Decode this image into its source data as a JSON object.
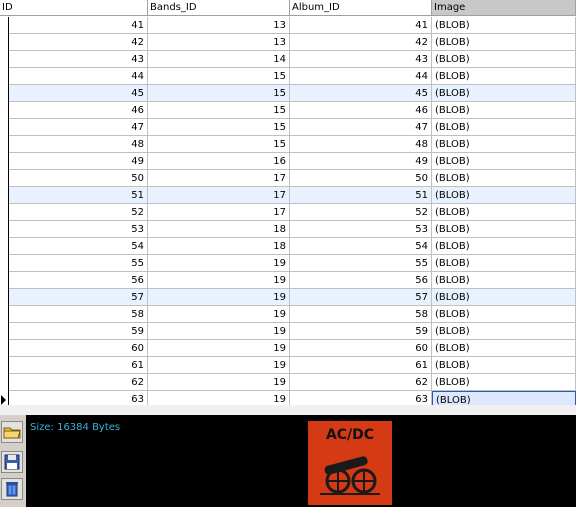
{
  "columns": [
    {
      "label": "ID"
    },
    {
      "label": "Bands_ID"
    },
    {
      "label": "Album_ID"
    },
    {
      "label": "Image"
    }
  ],
  "rows": [
    {
      "id": "41",
      "bands_id": "13",
      "album_id": "41",
      "image": "(BLOB)"
    },
    {
      "id": "42",
      "bands_id": "13",
      "album_id": "42",
      "image": "(BLOB)"
    },
    {
      "id": "43",
      "bands_id": "14",
      "album_id": "43",
      "image": "(BLOB)"
    },
    {
      "id": "44",
      "bands_id": "15",
      "album_id": "44",
      "image": "(BLOB)"
    },
    {
      "id": "45",
      "bands_id": "15",
      "album_id": "45",
      "image": "(BLOB)"
    },
    {
      "id": "46",
      "bands_id": "15",
      "album_id": "46",
      "image": "(BLOB)"
    },
    {
      "id": "47",
      "bands_id": "15",
      "album_id": "47",
      "image": "(BLOB)"
    },
    {
      "id": "48",
      "bands_id": "15",
      "album_id": "48",
      "image": "(BLOB)"
    },
    {
      "id": "49",
      "bands_id": "16",
      "album_id": "49",
      "image": "(BLOB)"
    },
    {
      "id": "50",
      "bands_id": "17",
      "album_id": "50",
      "image": "(BLOB)"
    },
    {
      "id": "51",
      "bands_id": "17",
      "album_id": "51",
      "image": "(BLOB)"
    },
    {
      "id": "52",
      "bands_id": "17",
      "album_id": "52",
      "image": "(BLOB)"
    },
    {
      "id": "53",
      "bands_id": "18",
      "album_id": "53",
      "image": "(BLOB)"
    },
    {
      "id": "54",
      "bands_id": "18",
      "album_id": "54",
      "image": "(BLOB)"
    },
    {
      "id": "55",
      "bands_id": "19",
      "album_id": "55",
      "image": "(BLOB)"
    },
    {
      "id": "56",
      "bands_id": "19",
      "album_id": "56",
      "image": "(BLOB)"
    },
    {
      "id": "57",
      "bands_id": "19",
      "album_id": "57",
      "image": "(BLOB)"
    },
    {
      "id": "58",
      "bands_id": "19",
      "album_id": "58",
      "image": "(BLOB)"
    },
    {
      "id": "59",
      "bands_id": "19",
      "album_id": "59",
      "image": "(BLOB)"
    },
    {
      "id": "60",
      "bands_id": "19",
      "album_id": "60",
      "image": "(BLOB)"
    },
    {
      "id": "61",
      "bands_id": "19",
      "album_id": "61",
      "image": "(BLOB)"
    },
    {
      "id": "62",
      "bands_id": "19",
      "album_id": "62",
      "image": "(BLOB)"
    },
    {
      "id": "63",
      "bands_id": "19",
      "album_id": "63",
      "image": "(BLOB)"
    }
  ],
  "selected_row": 22,
  "alt_rows": [
    4,
    10,
    16
  ],
  "blob_panel": {
    "size_text": "Size: 16384 Bytes",
    "image_logo_text": "AC/DC",
    "tools": [
      {
        "name": "open-folder-icon"
      },
      {
        "name": "save-disk-icon"
      },
      {
        "name": "trash-icon"
      }
    ]
  },
  "colors": {
    "accent_text": "#3ab0d8",
    "row_alt": "#e8f2ff",
    "selection_border": "#2a5bab",
    "panel_bg": "#000000"
  }
}
